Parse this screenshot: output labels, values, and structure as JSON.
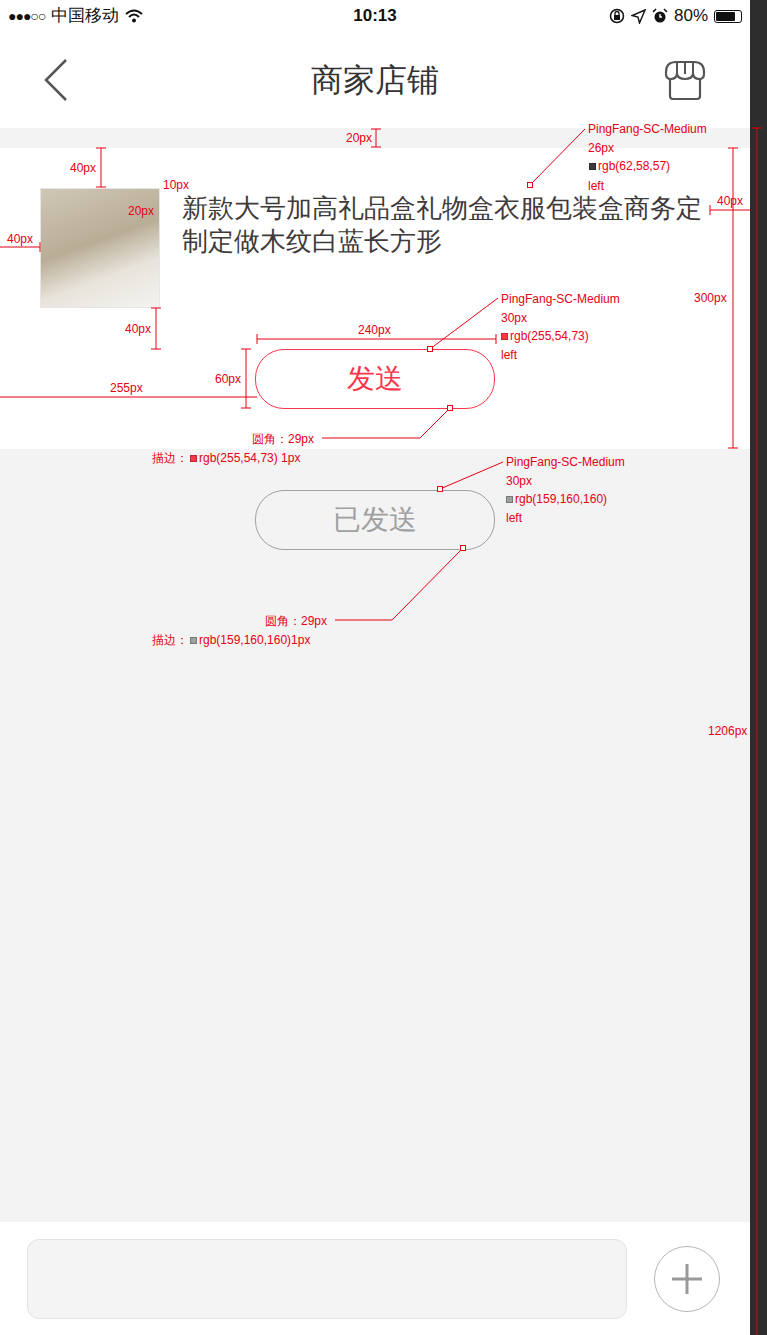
{
  "status_bar": {
    "signal": "●●●○○",
    "carrier": "中国移动",
    "time": "10:13",
    "battery": "80%",
    "battery_level": 0.8
  },
  "nav": {
    "title": "商家店铺"
  },
  "product": {
    "title": "新款大号加高礼品盒礼物盒衣服包装盒商务定制定做木纹白蓝长方形"
  },
  "buttons": [
    {
      "label": "发送",
      "disabled": false
    },
    {
      "label": "已发送",
      "disabled": true
    }
  ],
  "annotations": [
    {
      "text": "20px"
    },
    {
      "text": "PingFang-SC-Medium"
    },
    {
      "text": "26px"
    },
    {
      "text": "rgb(62,58,57)",
      "color": "#3e3a39"
    },
    {
      "text": "left"
    },
    {
      "text": "40px"
    },
    {
      "text": "10px"
    },
    {
      "text": "20px"
    },
    {
      "text": "40px"
    },
    {
      "text": "40px"
    },
    {
      "text": "300px"
    },
    {
      "text": "40px"
    },
    {
      "text": "PingFang-SC-Medium"
    },
    {
      "text": "30px"
    },
    {
      "text": "rgb(255,54,73)",
      "color": "#ff3649"
    },
    {
      "text": "left"
    },
    {
      "text": "240px"
    },
    {
      "text": "60px"
    },
    {
      "text": "255px"
    },
    {
      "text": "圆角：29px"
    },
    {
      "prefix": "描边：",
      "text": "rgb(255,54,73) 1px",
      "color": "#ff3649"
    },
    {
      "text": "PingFang-SC-Medium"
    },
    {
      "text": "30px"
    },
    {
      "text": "rgb(159,160,160)",
      "color": "#9fa0a0"
    },
    {
      "text": "left"
    },
    {
      "text": "圆角：29px"
    },
    {
      "prefix": "描边：",
      "text": "rgb(159,160,160)1px",
      "color": "#9fa0a0"
    },
    {
      "text": "1206px"
    }
  ]
}
